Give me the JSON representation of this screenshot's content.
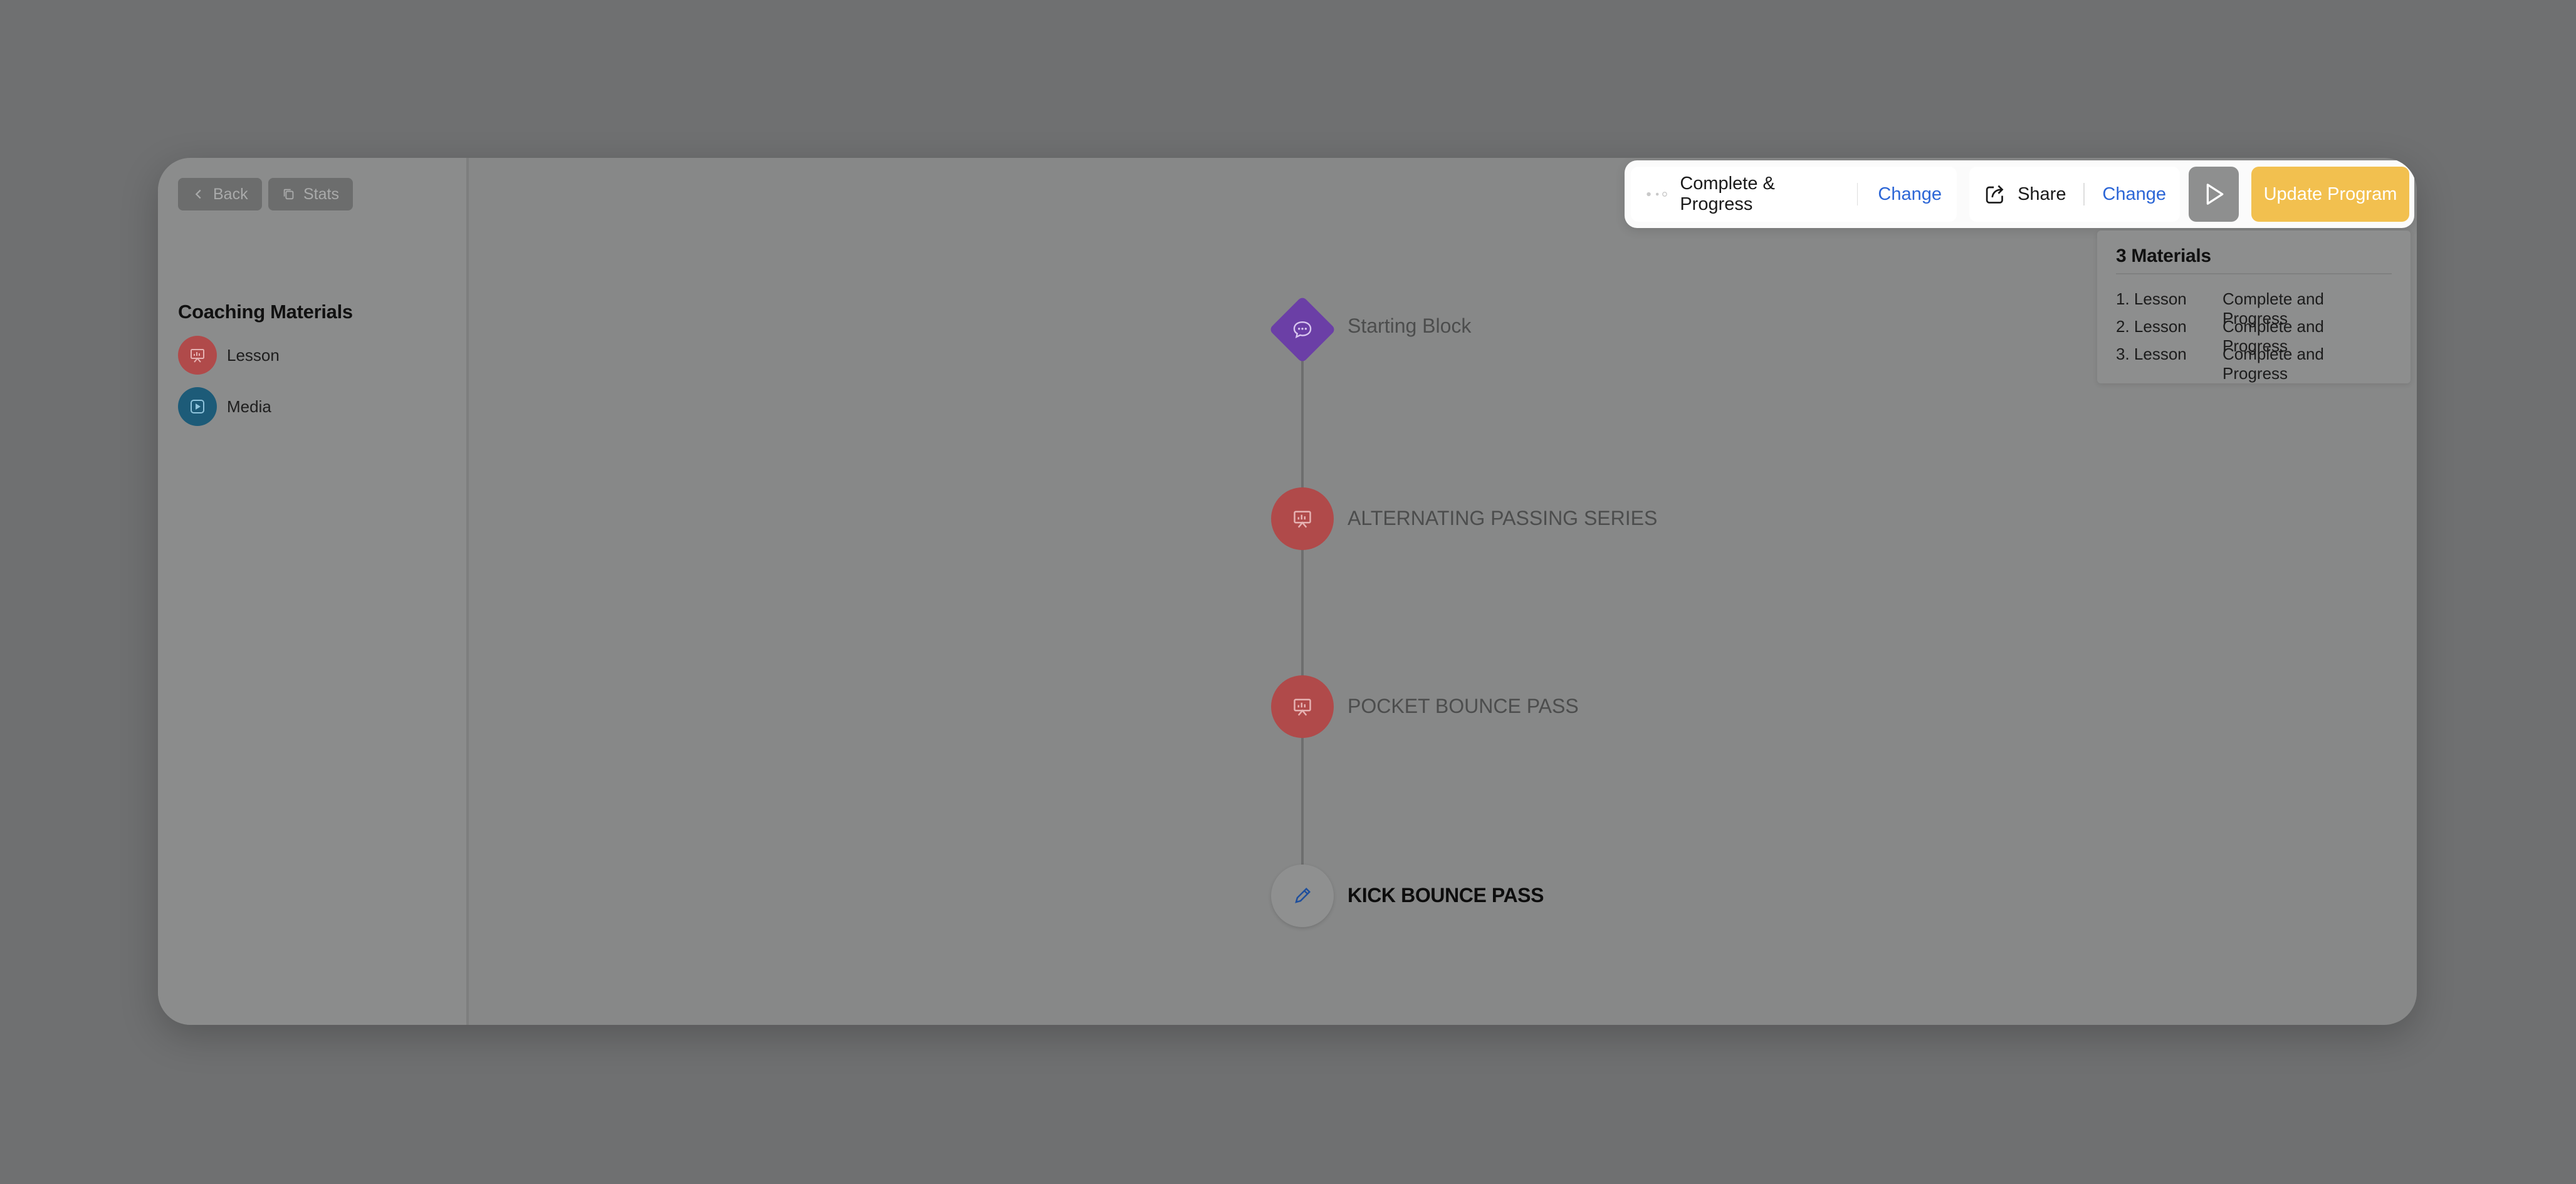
{
  "sidebar": {
    "back_label": "Back",
    "stats_label": "Stats",
    "section_title": "Coaching Materials",
    "materials": [
      {
        "label": "Lesson",
        "icon": "presentation-icon",
        "color": "#b04a4a"
      },
      {
        "label": "Media",
        "icon": "play-square-icon",
        "color": "#1d5b78"
      }
    ]
  },
  "toolbar": {
    "completion_label": "Complete & Progress",
    "completion_change": "Change",
    "share_label": "Share",
    "share_change": "Change",
    "update_label": "Update Program",
    "accent": "#f2c04f",
    "link_color": "#2c66d6"
  },
  "summary": {
    "title": "3 Materials",
    "rows": [
      {
        "name": "1. Lesson",
        "status": "Complete and Progress"
      },
      {
        "name": "2. Lesson",
        "status": "Complete and Progress"
      },
      {
        "name": "3. Lesson",
        "status": "Complete and Progress"
      }
    ]
  },
  "timeline": {
    "nodes": [
      {
        "label": "Starting Block",
        "icon": "chat-bubble-icon",
        "color": "#6b3fa6"
      },
      {
        "label": "ALTERNATING PASSING SERIES",
        "icon": "presentation-icon",
        "color": "#b04a4a"
      },
      {
        "label": "POCKET BOUNCE PASS",
        "icon": "presentation-icon",
        "color": "#b04a4a"
      },
      {
        "label": "KICK BOUNCE PASS",
        "icon": "pencil-icon",
        "color": "#8f9090"
      }
    ]
  }
}
